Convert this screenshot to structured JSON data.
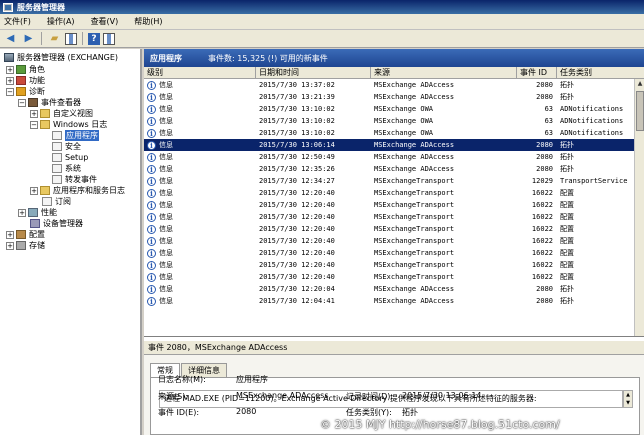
{
  "window": {
    "title": "服务器管理器"
  },
  "menu": {
    "items": [
      "文件(F)",
      "操作(A)",
      "查看(V)",
      "帮助(H)"
    ]
  },
  "toolbar": {
    "icons": [
      "back-arrow-icon",
      "forward-arrow-icon",
      "folder-up-icon",
      "show-hide-icon",
      "help-icon",
      "panel-icon"
    ]
  },
  "tree": {
    "root": "服务器管理器 (EXCHANGE)",
    "roles": "角色",
    "features": "功能",
    "diagnostics": "诊断",
    "event_viewer": "事件查看器",
    "custom_views": "自定义视图",
    "windows_logs": "Windows 日志",
    "application": "应用程序",
    "security": "安全",
    "setup": "Setup",
    "system": "系统",
    "forwarded": "转发事件",
    "app_service_logs": "应用程序和服务日志",
    "subscriptions": "订阅",
    "performance": "性能",
    "device_manager": "设备管理器",
    "configuration": "配置",
    "storage": "存储"
  },
  "pane": {
    "title": "应用程序",
    "summary": "事件数: 15,325 (!) 可用的新事件"
  },
  "grid": {
    "columns": [
      "级别",
      "日期和时间",
      "来源",
      "事件 ID",
      "任务类别"
    ],
    "rows": [
      {
        "level": "信息",
        "datetime": "2015/7/30 13:37:02",
        "source": "MSExchange ADAccess",
        "id": "2080",
        "task": "拓扑"
      },
      {
        "level": "信息",
        "datetime": "2015/7/30 13:21:39",
        "source": "MSExchange ADAccess",
        "id": "2080",
        "task": "拓扑"
      },
      {
        "level": "信息",
        "datetime": "2015/7/30 13:10:02",
        "source": "MSExchange OWA",
        "id": "63",
        "task": "ADNotifications"
      },
      {
        "level": "信息",
        "datetime": "2015/7/30 13:10:02",
        "source": "MSExchange OWA",
        "id": "63",
        "task": "ADNotifications"
      },
      {
        "level": "信息",
        "datetime": "2015/7/30 13:10:02",
        "source": "MSExchange OWA",
        "id": "63",
        "task": "ADNotifications"
      },
      {
        "level": "信息",
        "datetime": "2015/7/30 13:06:14",
        "source": "MSExchange ADAccess",
        "id": "2080",
        "task": "拓扑"
      },
      {
        "level": "信息",
        "datetime": "2015/7/30 12:50:49",
        "source": "MSExchange ADAccess",
        "id": "2080",
        "task": "拓扑"
      },
      {
        "level": "信息",
        "datetime": "2015/7/30 12:35:26",
        "source": "MSExchange ADAccess",
        "id": "2080",
        "task": "拓扑"
      },
      {
        "level": "信息",
        "datetime": "2015/7/30 12:34:27",
        "source": "MSExchangeTransport",
        "id": "12029",
        "task": "TransportService"
      },
      {
        "level": "信息",
        "datetime": "2015/7/30 12:20:40",
        "source": "MSExchangeTransport",
        "id": "16022",
        "task": "配置"
      },
      {
        "level": "信息",
        "datetime": "2015/7/30 12:20:40",
        "source": "MSExchangeTransport",
        "id": "16022",
        "task": "配置"
      },
      {
        "level": "信息",
        "datetime": "2015/7/30 12:20:40",
        "source": "MSExchangeTransport",
        "id": "16022",
        "task": "配置"
      },
      {
        "level": "信息",
        "datetime": "2015/7/30 12:20:40",
        "source": "MSExchangeTransport",
        "id": "16022",
        "task": "配置"
      },
      {
        "level": "信息",
        "datetime": "2015/7/30 12:20:40",
        "source": "MSExchangeTransport",
        "id": "16022",
        "task": "配置"
      },
      {
        "level": "信息",
        "datetime": "2015/7/30 12:20:40",
        "source": "MSExchangeTransport",
        "id": "16022",
        "task": "配置"
      },
      {
        "level": "信息",
        "datetime": "2015/7/30 12:20:40",
        "source": "MSExchangeTransport",
        "id": "16022",
        "task": "配置"
      },
      {
        "level": "信息",
        "datetime": "2015/7/30 12:20:40",
        "source": "MSExchangeTransport",
        "id": "16022",
        "task": "配置"
      },
      {
        "level": "信息",
        "datetime": "2015/7/30 12:20:04",
        "source": "MSExchange ADAccess",
        "id": "2080",
        "task": "拓扑"
      },
      {
        "level": "信息",
        "datetime": "2015/7/30 12:04:41",
        "source": "MSExchange ADAccess",
        "id": "2080",
        "task": "拓扑"
      }
    ],
    "selected_index": 5
  },
  "detail": {
    "header": "事件 2080，MSExchange ADAccess",
    "tabs": [
      "常规",
      "详细信息"
    ],
    "description": "进程 MAD.EXE (PID=11200)。Exchange Active Directory 提供程序发现以下具有所述特征的服务器:",
    "log_name_label": "日志名称(M):",
    "log_name_value": "应用程序",
    "source_label": "来源(S):",
    "source_value": "MSExchange ADAccess",
    "logged_label": "记录时间(D):",
    "logged_value": "2015/7/30 13:06:14",
    "event_id_label": "事件 ID(E):",
    "event_id_value": "2080",
    "task_label": "任务类别(Y):",
    "task_value": "拓扑"
  },
  "watermark": "© 2015 MJY http://horse87.blog.51cto.com/"
}
